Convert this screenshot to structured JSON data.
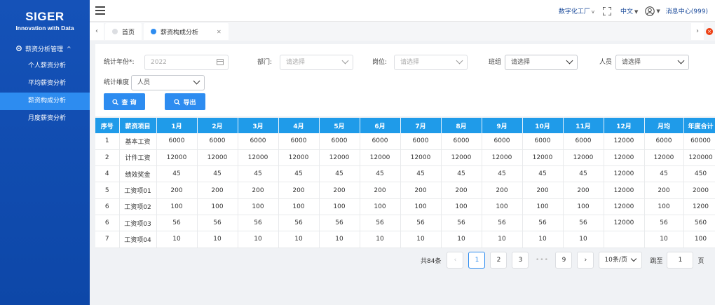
{
  "sidebar": {
    "brand": "SIGER",
    "tagline": "Innovation with Data",
    "group_label": "薪资分析管理",
    "items": [
      {
        "label": "个人薪资分析"
      },
      {
        "label": "平均薪资分析"
      },
      {
        "label": "薪资构成分析",
        "active": true
      },
      {
        "label": "月度薪资分析"
      }
    ]
  },
  "header": {
    "factory": "数字化工厂",
    "language": "中文",
    "messages": "消息中心(999)"
  },
  "tabs": [
    {
      "label": "首页",
      "dot_color": "#dcdee2"
    },
    {
      "label": "薪资构成分析",
      "dot_color": "#2d8cf0"
    }
  ],
  "filters": {
    "year_label": "统计年份*:",
    "year_placeholder": "2022",
    "dept_label": "部门:",
    "dept_placeholder": "请选择",
    "post_label": "岗位:",
    "post_placeholder": "请选择",
    "team_label": "班组",
    "team_placeholder": "请选择",
    "person_label": "人员",
    "person_placeholder": "请选择",
    "dimension_label": "统计维度",
    "dimension_value": "人员",
    "query_button": "查 询",
    "export_button": "导出"
  },
  "table": {
    "headers": [
      "序号",
      "薪资项目",
      "1月",
      "2月",
      "3月",
      "4月",
      "5月",
      "6月",
      "7月",
      "8月",
      "9月",
      "10月",
      "11月",
      "12月",
      "月均",
      "年度合计"
    ],
    "rows": [
      [
        "1",
        "基本工资",
        "6000",
        "6000",
        "6000",
        "6000",
        "6000",
        "6000",
        "6000",
        "6000",
        "6000",
        "6000",
        "6000",
        "12000",
        "6000",
        "60000"
      ],
      [
        "2",
        "计件工资",
        "12000",
        "12000",
        "12000",
        "12000",
        "12000",
        "12000",
        "12000",
        "12000",
        "12000",
        "12000",
        "12000",
        "12000",
        "12000",
        "120000"
      ],
      [
        "4",
        "绩效奖金",
        "45",
        "45",
        "45",
        "45",
        "45",
        "45",
        "45",
        "45",
        "45",
        "45",
        "45",
        "12000",
        "45",
        "450"
      ],
      [
        "5",
        "工资项01",
        "200",
        "200",
        "200",
        "200",
        "200",
        "200",
        "200",
        "200",
        "200",
        "200",
        "200",
        "12000",
        "200",
        "2000"
      ],
      [
        "6",
        "工资项02",
        "100",
        "100",
        "100",
        "100",
        "100",
        "100",
        "100",
        "100",
        "100",
        "100",
        "100",
        "12000",
        "100",
        "1200"
      ],
      [
        "6",
        "工资项03",
        "56",
        "56",
        "56",
        "56",
        "56",
        "56",
        "56",
        "56",
        "56",
        "56",
        "56",
        "12000",
        "56",
        "560"
      ],
      [
        "7",
        "工资项04",
        "10",
        "10",
        "10",
        "10",
        "10",
        "10",
        "10",
        "10",
        "10",
        "10",
        "10",
        "",
        "10",
        "100"
      ]
    ]
  },
  "pagination": {
    "total": "共84条",
    "pages": [
      "1",
      "2",
      "3"
    ],
    "ellipsis": "•••",
    "last_page": "9",
    "current_page": "1",
    "page_size": "10条/页",
    "jump_label": "跳至",
    "jump_value": "1",
    "page_suffix": "页"
  }
}
